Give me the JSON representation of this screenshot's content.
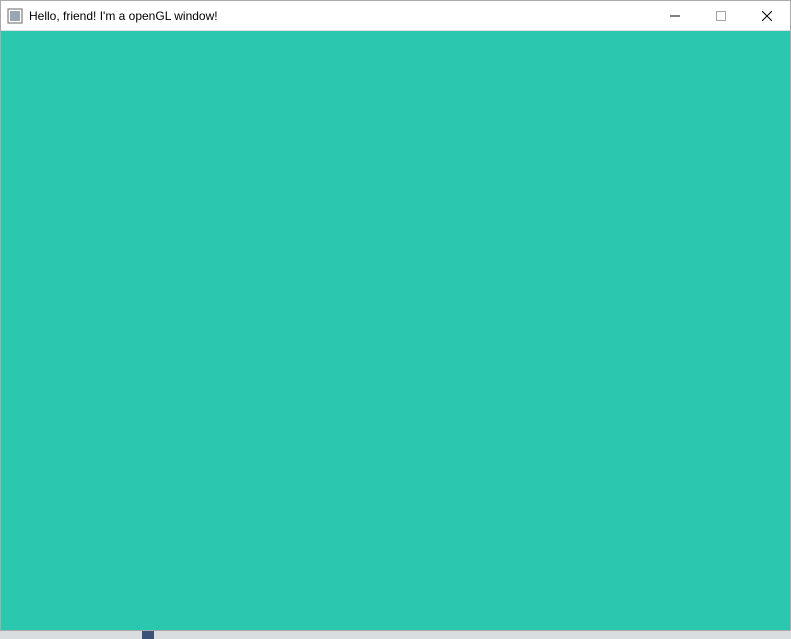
{
  "window": {
    "title": "Hello, friend! I'm a openGL window!",
    "clear_color": "#2ac9af"
  },
  "controls": {
    "minimize": "minimize",
    "maximize": "maximize",
    "close": "close"
  }
}
